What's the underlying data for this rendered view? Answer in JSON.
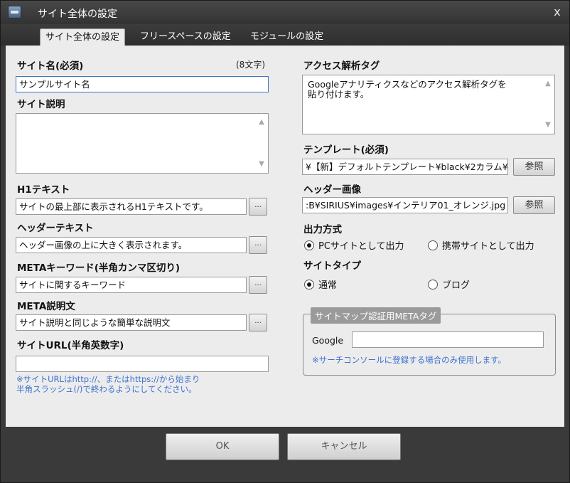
{
  "window": {
    "title": "サイト全体の設定",
    "close_glyph": "x"
  },
  "tabs": [
    {
      "label": "サイト全体の設定",
      "active": true
    },
    {
      "label": "フリースペースの設定",
      "active": false
    },
    {
      "label": "モジュールの設定",
      "active": false
    }
  ],
  "left": {
    "site_name": {
      "label": "サイト名(必須)",
      "note": "(8文字)",
      "value": "サンプルサイト名"
    },
    "site_description": {
      "label": "サイト説明",
      "value": ""
    },
    "h1_text": {
      "label": "H1テキスト",
      "value": "サイトの最上部に表示されるH1テキストです。",
      "button": "..."
    },
    "header_text": {
      "label": "ヘッダーテキスト",
      "value": "ヘッダー画像の上に大きく表示されます。",
      "button": "..."
    },
    "meta_keywords": {
      "label": "METAキーワード(半角カンマ区切り)",
      "value": "サイトに関するキーワード",
      "button": "..."
    },
    "meta_description": {
      "label": "META説明文",
      "value": "サイト説明と同じような簡単な説明文",
      "button": "..."
    },
    "site_url": {
      "label": "サイトURL(半角英数字)",
      "value": "",
      "note_line1": "※サイトURLはhttp://、またはhttps://から始まり",
      "note_line2": "半角スラッシュ(/)で終わるようにしてください。"
    }
  },
  "right": {
    "access_tag": {
      "label": "アクセス解析タグ",
      "value": "Googleアナリティクスなどのアクセス解析タグを\n貼り付けます。"
    },
    "template": {
      "label": "テンプレート(必須)",
      "value": "¥【新】デフォルトテンプレート¥black¥2カラム¥",
      "button": "参照"
    },
    "header_image": {
      "label": "ヘッダー画像",
      "value": ":B¥SIRIUS¥images¥インテリア01_オレンジ.jpg",
      "button": "参照"
    },
    "output_mode": {
      "label": "出力方式",
      "options": [
        "PCサイトとして出力",
        "携帯サイトとして出力"
      ],
      "selected": 0
    },
    "site_type": {
      "label": "サイトタイプ",
      "options": [
        "通常",
        "ブログ"
      ],
      "selected": 0
    },
    "sitemap_meta": {
      "legend": "サイトマップ認証用METAタグ",
      "google_label": "Google",
      "google_value": "",
      "note": "※サーチコンソールに登録する場合のみ使用します。"
    }
  },
  "footer": {
    "ok": "OK",
    "cancel": "キャンセル"
  }
}
